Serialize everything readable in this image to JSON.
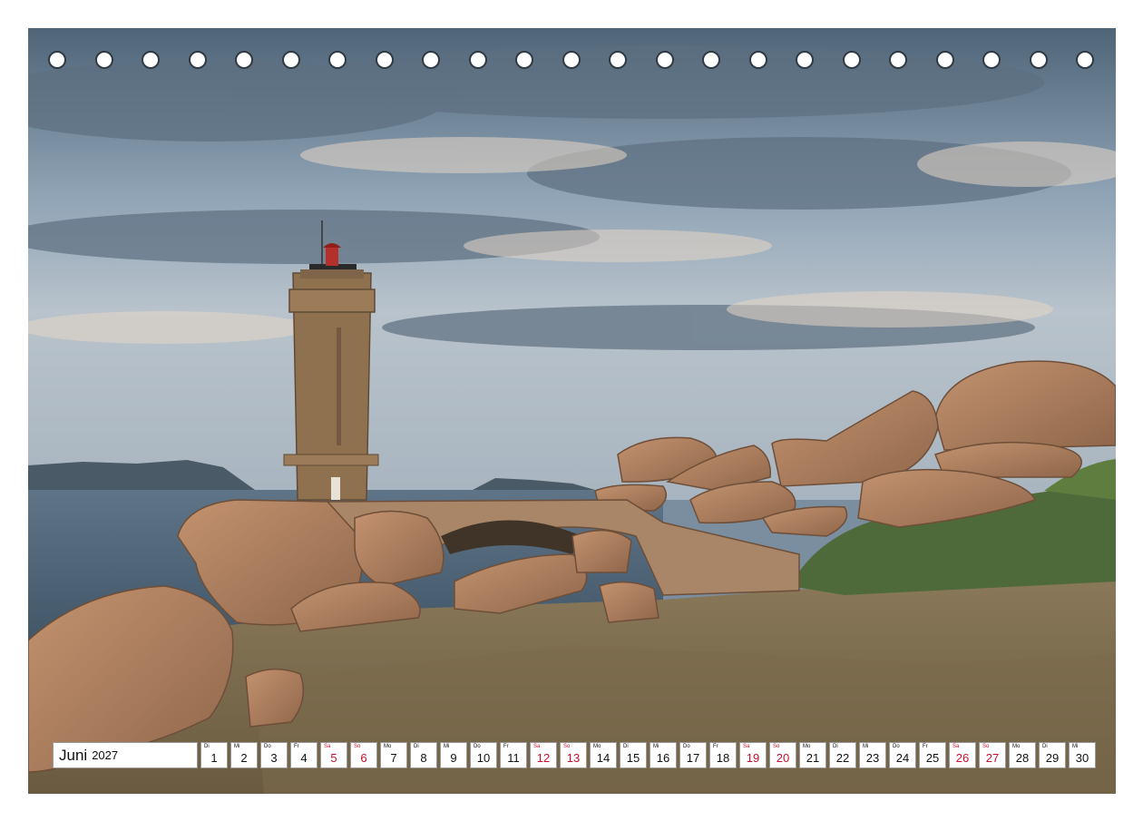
{
  "calendar": {
    "month": "Juni",
    "year": "2027",
    "weekend_color": "#c8102e",
    "days": [
      {
        "wd": "Di",
        "d": "1"
      },
      {
        "wd": "Mi",
        "d": "2"
      },
      {
        "wd": "Do",
        "d": "3"
      },
      {
        "wd": "Fr",
        "d": "4"
      },
      {
        "wd": "Sa",
        "d": "5",
        "we": true
      },
      {
        "wd": "So",
        "d": "6",
        "we": true
      },
      {
        "wd": "Mo",
        "d": "7"
      },
      {
        "wd": "Di",
        "d": "8"
      },
      {
        "wd": "Mi",
        "d": "9"
      },
      {
        "wd": "Do",
        "d": "10"
      },
      {
        "wd": "Fr",
        "d": "11"
      },
      {
        "wd": "Sa",
        "d": "12",
        "we": true
      },
      {
        "wd": "So",
        "d": "13",
        "we": true
      },
      {
        "wd": "Mo",
        "d": "14"
      },
      {
        "wd": "Di",
        "d": "15"
      },
      {
        "wd": "Mi",
        "d": "16"
      },
      {
        "wd": "Do",
        "d": "17"
      },
      {
        "wd": "Fr",
        "d": "18"
      },
      {
        "wd": "Sa",
        "d": "19",
        "we": true
      },
      {
        "wd": "So",
        "d": "20",
        "we": true
      },
      {
        "wd": "Mo",
        "d": "21"
      },
      {
        "wd": "Di",
        "d": "22"
      },
      {
        "wd": "Mi",
        "d": "23"
      },
      {
        "wd": "Do",
        "d": "24"
      },
      {
        "wd": "Fr",
        "d": "25"
      },
      {
        "wd": "Sa",
        "d": "26",
        "we": true
      },
      {
        "wd": "So",
        "d": "27",
        "we": true
      },
      {
        "wd": "Mo",
        "d": "28"
      },
      {
        "wd": "Di",
        "d": "29"
      },
      {
        "wd": "Mi",
        "d": "30"
      }
    ]
  },
  "binding": {
    "hole_count": 23
  },
  "photo": {
    "subject": "lighthouse-on-granite-coast"
  }
}
